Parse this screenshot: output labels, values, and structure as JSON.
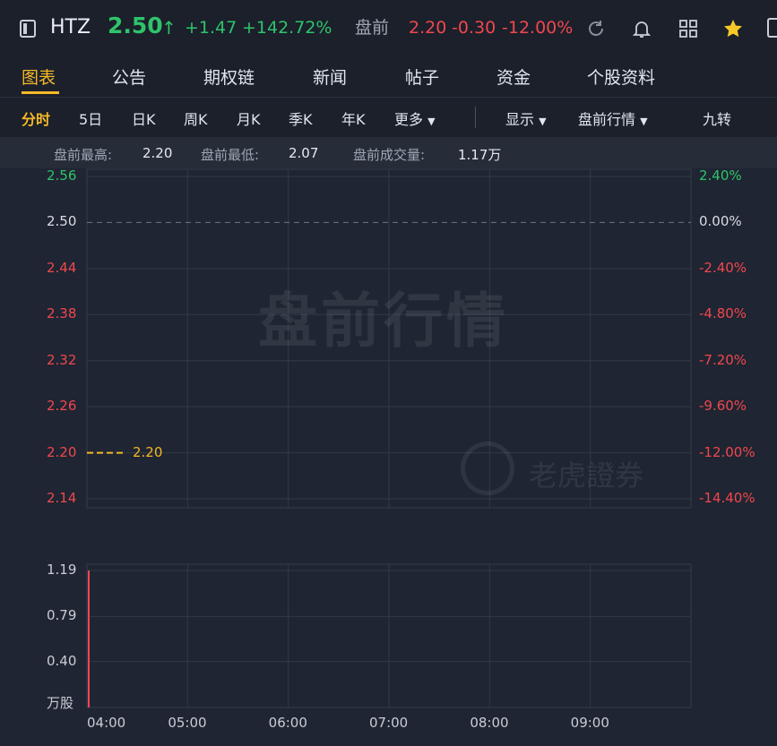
{
  "header": {
    "symbol": "HTZ",
    "price": "2.50",
    "change": "+1.47",
    "change_pct": "+142.72%",
    "pre_label": "盘前",
    "pre_price": "2.20",
    "pre_change": "-0.30",
    "pre_change_pct": "-12.00%"
  },
  "tabs": [
    "图表",
    "公告",
    "期权链",
    "新闻",
    "帖子",
    "资金",
    "个股资料"
  ],
  "periods": [
    "分时",
    "5日",
    "日K",
    "周K",
    "月K",
    "季K",
    "年K",
    "更多"
  ],
  "display_label": "显示",
  "session_label": "盘前行情",
  "nine_turn_label": "九转",
  "info": {
    "high_label": "盘前最高:",
    "high": "2.20",
    "low_label": "盘前最低:",
    "low": "2.07",
    "vol_label": "盘前成交量:",
    "vol": "1.17万"
  },
  "watermark": "盘前行情",
  "brand_watermark": "老虎證券",
  "price_line_label": "2.20",
  "chart_data": {
    "type": "line",
    "y_left_ticks": [
      "2.56",
      "2.50",
      "2.44",
      "2.38",
      "2.32",
      "2.26",
      "2.20",
      "2.14"
    ],
    "y_right_ticks": [
      "2.40%",
      "0.00%",
      "-2.40%",
      "-4.80%",
      "-7.20%",
      "-9.60%",
      "-12.00%",
      "-14.40%"
    ],
    "ylim": [
      2.14,
      2.56
    ],
    "prev_close": 2.5,
    "current_price": 2.2,
    "x_ticks": [
      "04:00",
      "05:00",
      "06:00",
      "07:00",
      "08:00",
      "09:00"
    ],
    "volume_ticks": [
      "1.19",
      "0.79",
      "0.40"
    ],
    "volume_unit": "万股",
    "volume_bars": [
      {
        "x": "04:00",
        "value": 1.19
      }
    ],
    "colors": {
      "up": "#2fc36a",
      "down": "#f0474e",
      "accent": "#f6b927"
    }
  }
}
